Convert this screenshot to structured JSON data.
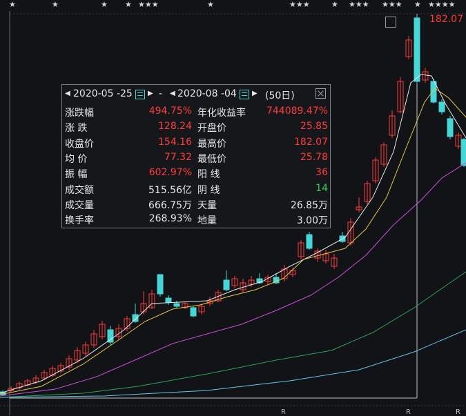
{
  "top_markers": [
    "★",
    "★",
    "★",
    "★",
    "★★★",
    "★",
    "★★★",
    "★",
    "★★★",
    "★★★",
    "★",
    "★★★★"
  ],
  "max_price_label": "182.07",
  "panel": {
    "start_date": "2020-05 -25",
    "separator": "-",
    "end_date": "2020-08 -04",
    "days": "(50日)",
    "rows": [
      {
        "l1": "涨跌幅",
        "v1": "494.75%",
        "c1": "red",
        "l2": "年化收益率",
        "v2": "744089.47%",
        "c2": "red"
      },
      {
        "l1": "涨  跌",
        "v1": "128.24",
        "c1": "red",
        "l2": "开盘价",
        "v2": "25.85",
        "c2": "red"
      },
      {
        "l1": "收盘价",
        "v1": "154.16",
        "c1": "red",
        "l2": "最高价",
        "v2": "182.07",
        "c2": "red"
      },
      {
        "l1": "均  价",
        "v1": "77.32",
        "c1": "red",
        "l2": "最低价",
        "v2": "25.78",
        "c2": "red"
      },
      {
        "l1": "振  幅",
        "v1": "602.97%",
        "c1": "red",
        "l2": "阳  线",
        "v2": "36",
        "c2": "red"
      },
      {
        "l1": "成交额",
        "v1": "515.56亿",
        "c1": "white",
        "l2": "阴  线",
        "v2": "14",
        "c2": "green"
      },
      {
        "l1": "成交量",
        "v1": "666.75万",
        "c1": "white",
        "l2": "天量",
        "v2": "26.85万",
        "c2": "white"
      },
      {
        "l1": "换手率",
        "v1": "268.93%",
        "c1": "white",
        "l2": "地量",
        "v2": "3.00万",
        "c2": "white"
      }
    ]
  },
  "bottom_markers": [
    "R",
    "R",
    "R"
  ],
  "colors": {
    "up": "#ff3b3b",
    "down": "#46d6d6",
    "ma5": "#e8e8e8",
    "ma10": "#e6c84a",
    "ma20": "#c84fd8",
    "ma60": "#2fa35a",
    "ma120": "#6fc3e8"
  }
}
